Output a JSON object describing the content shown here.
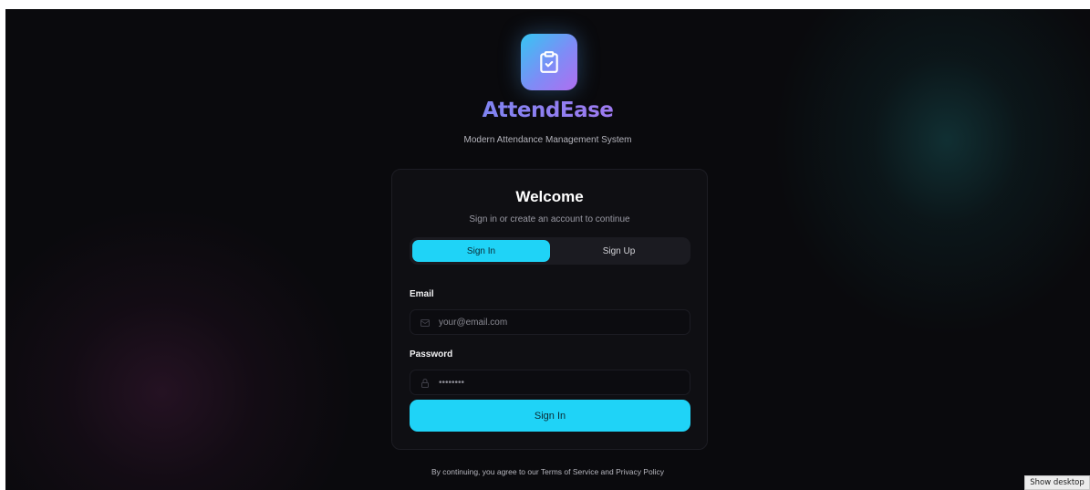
{
  "brand": {
    "logo_icon": "clipboard-check-icon",
    "name": "AttendEase",
    "tagline": "Modern Attendance Management System"
  },
  "card": {
    "title": "Welcome",
    "subtitle": "Sign in or create an account to continue",
    "tabs": [
      {
        "label": "Sign In",
        "active": true
      },
      {
        "label": "Sign Up",
        "active": false
      }
    ],
    "email": {
      "label": "Email",
      "icon": "mail-icon",
      "placeholder": "your@email.com",
      "value": ""
    },
    "password": {
      "label": "Password",
      "icon": "lock-icon",
      "placeholder": "••••••••",
      "value": ""
    },
    "submit_label": "Sign In"
  },
  "footer": {
    "legal": "By continuing, you agree to our Terms of Service and Privacy Policy"
  },
  "taskbar": {
    "show_desktop": "Show desktop"
  },
  "colors": {
    "accent": "#1fd3f7",
    "background": "#0a0a0d",
    "card": "#0f0f13",
    "brand_gradient_start": "#5c8ff2",
    "brand_gradient_end": "#a877f0"
  }
}
